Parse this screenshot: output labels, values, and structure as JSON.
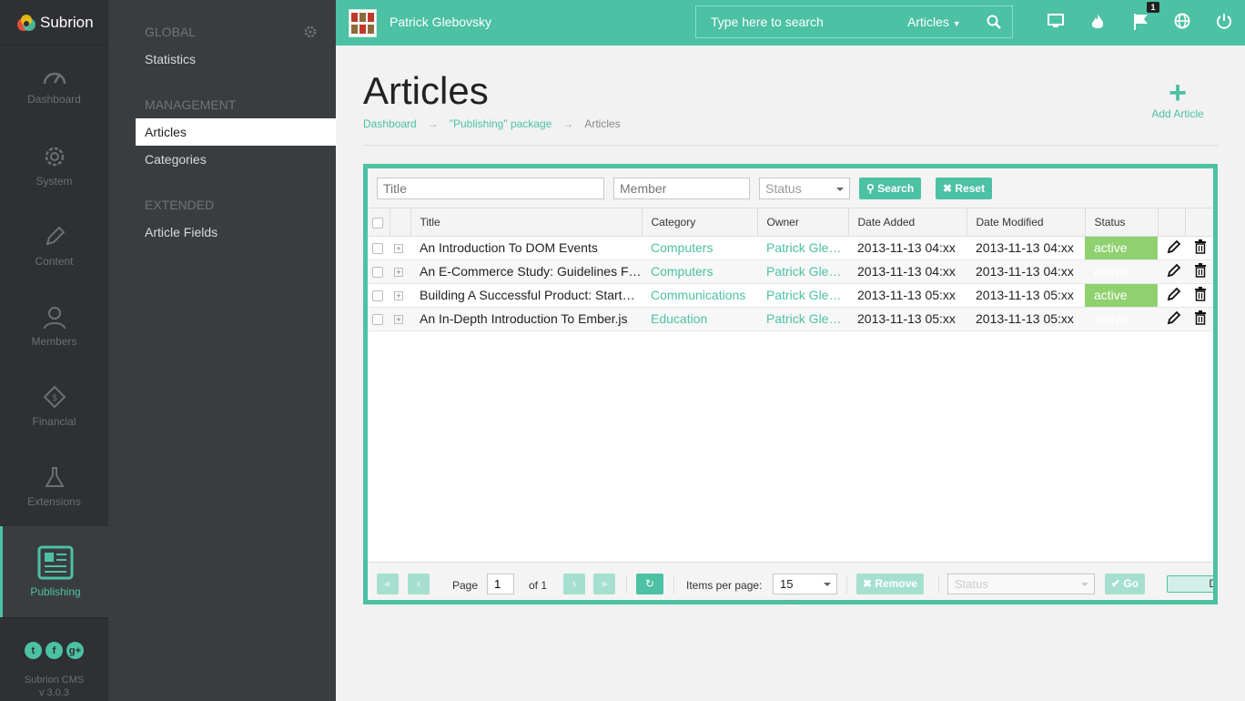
{
  "app": {
    "name": "Subrion",
    "cms_label": "Subrion CMS",
    "version": "v 3.0.3"
  },
  "leftnav": {
    "items": [
      {
        "label": "Dashboard",
        "icon": "gauge-icon"
      },
      {
        "label": "System",
        "icon": "gear-icon"
      },
      {
        "label": "Content",
        "icon": "pencil-icon"
      },
      {
        "label": "Members",
        "icon": "user-icon"
      },
      {
        "label": "Financial",
        "icon": "money-tag-icon"
      },
      {
        "label": "Extensions",
        "icon": "flask-icon"
      },
      {
        "label": "Publishing",
        "icon": "newspaper-icon",
        "active": true
      }
    ],
    "social": [
      "twitter-icon",
      "facebook-icon",
      "googleplus-icon"
    ]
  },
  "subnav": {
    "global_heading": "GLOBAL",
    "global_items": [
      "Statistics"
    ],
    "management_heading": "MANAGEMENT",
    "management_items": [
      "Articles",
      "Categories"
    ],
    "extended_heading": "EXTENDED",
    "extended_items": [
      "Article Fields"
    ],
    "active": "Articles"
  },
  "topbar": {
    "username": "Patrick Glebovsky",
    "search_placeholder": "Type here to search",
    "search_scope": "Articles",
    "flag_badge": "1",
    "icons": [
      "monitor-icon",
      "fire-icon",
      "flag-icon",
      "globe-icon",
      "power-icon"
    ]
  },
  "page": {
    "title": "Articles",
    "breadcrumb": [
      "Dashboard",
      "\"Publishing\" package",
      "Articles"
    ],
    "breadcrumb_sep": "→",
    "add_label": "Add Article"
  },
  "filters": {
    "title_placeholder": "Title",
    "member_placeholder": "Member",
    "status_placeholder": "Status",
    "search_label": "Search",
    "reset_label": "Reset"
  },
  "table": {
    "columns": [
      "Title",
      "Category",
      "Owner",
      "Date Added",
      "Date Modified",
      "Status"
    ],
    "rows": [
      {
        "title": "An Introduction To DOM Events",
        "category": "Computers",
        "owner": "Patrick Glebovsky",
        "added": "2013-11-13 04:xx",
        "modified": "2013-11-13 04:xx",
        "status": "active"
      },
      {
        "title": "An E-Commerce Study: Guidelines For Better Navigation",
        "category": "Computers",
        "owner": "Patrick Glebovsky",
        "added": "2013-11-13 04:xx",
        "modified": "2013-11-13 04:xx",
        "status": "active"
      },
      {
        "title": "Building A Successful Product: Startup Tips",
        "category": "Communications",
        "owner": "Patrick Glebovsky",
        "added": "2013-11-13 05:xx",
        "modified": "2013-11-13 05:xx",
        "status": "active"
      },
      {
        "title": "An In-Depth Introduction To Ember.js",
        "category": "Education",
        "owner": "Patrick Glebovsky",
        "added": "2013-11-13 05:xx",
        "modified": "2013-11-13 05:xx",
        "status": "active"
      }
    ]
  },
  "pager": {
    "page_label": "Page",
    "page_value": "1",
    "of_label": "of 1",
    "items_label": "Items per page:",
    "items_value": "15",
    "remove_label": "Remove",
    "status_placeholder": "Status",
    "go_label": "Go",
    "cut_button_label": "D"
  },
  "colors": {
    "accent": "#4cc1a4",
    "dark": "#2e3033",
    "subnav": "#3a3d40",
    "status_active": "#8fd16f"
  }
}
